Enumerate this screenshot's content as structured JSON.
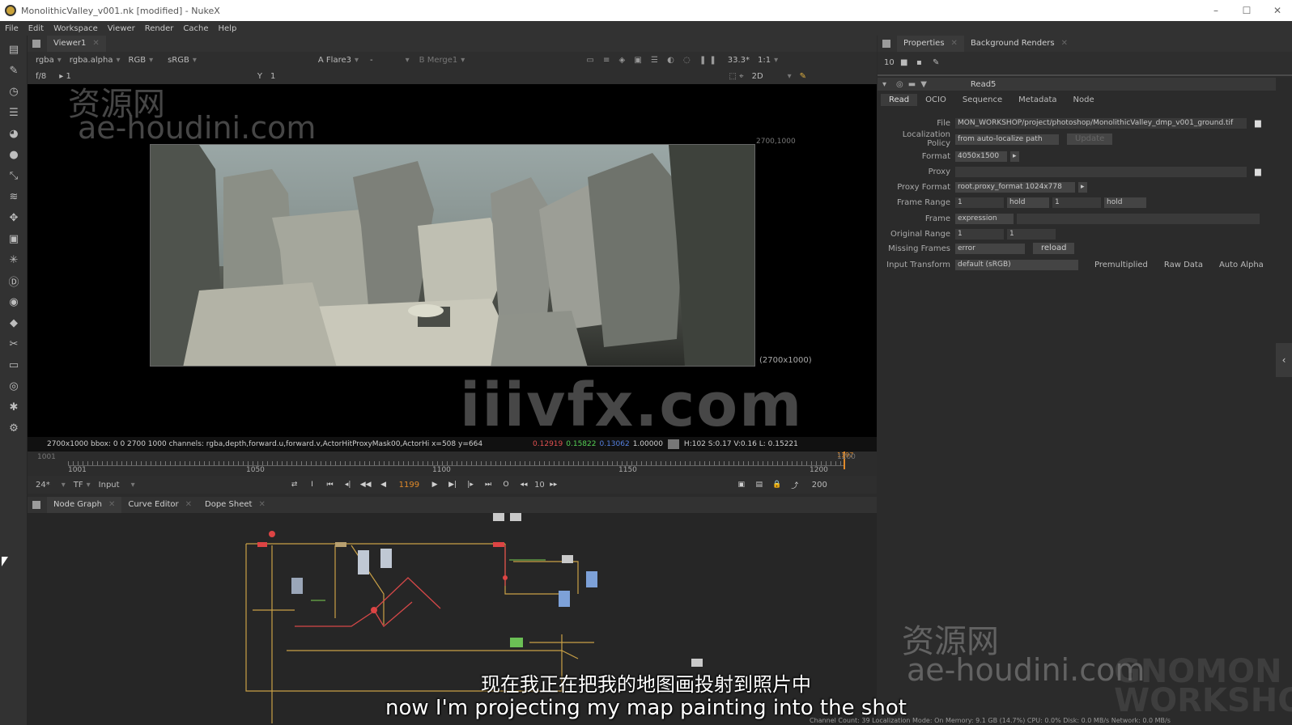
{
  "window": {
    "title": "MonolithicValley_v001.nk [modified] - NukeX",
    "controls": [
      "–",
      "☐",
      "✕"
    ]
  },
  "menu": [
    "File",
    "Edit",
    "Workspace",
    "Viewer",
    "Render",
    "Cache",
    "Help"
  ],
  "viewer": {
    "tab": "Viewer1",
    "channels": "rgba",
    "alpha": "rgba.alpha",
    "rgb": "RGB",
    "colorspace": "sRGB",
    "input_a": "A  Flare3",
    "input_a_op": "-",
    "input_b": "B  Merge1",
    "zoom": "33.3*",
    "ratio": "1:1",
    "fstop": "f/8",
    "gamma": "1",
    "y_label": "Y",
    "y_value": "1",
    "view_mode": "2D",
    "corner_tr": "2700,1000",
    "corner_br": "(2700x1000)"
  },
  "info_bar": {
    "text": "2700x1000  bbox: 0 0 2700 1000 channels: rgba,depth,forward.u,forward.v,ActorHitProxyMask00,ActorHi  x=508 y=664",
    "r": "0.12919",
    "g": "0.15822",
    "b": "0.13062",
    "a": "1.00000",
    "hsv": "H:102 S:0.17 V:0.16  L: 0.15221"
  },
  "timeline": {
    "start": "1001",
    "end": "1200",
    "ticks": [
      "1001",
      "1050",
      "1100",
      "1150",
      "1200"
    ],
    "playhead": "1197"
  },
  "playback": {
    "fps": "24*",
    "tf": "TF",
    "input": "Input",
    "current_frame": "1199",
    "increment": "10",
    "end_frame": "200"
  },
  "node_graph_tabs": [
    "Node Graph",
    "Curve Editor",
    "Dope Sheet"
  ],
  "properties": {
    "tabs": [
      "Properties",
      "Background Renders"
    ],
    "toolbar_count": "10",
    "node_name": "Read5",
    "subtabs": [
      "Read",
      "OCIO",
      "Sequence",
      "Metadata",
      "Node"
    ],
    "rows": {
      "file_label": "File",
      "file_value": "MON_WORKSHOP/project/photoshop/MonolithicValley_dmp_v001_ground.tif",
      "loc_label": "Localization Policy",
      "loc_value": "from auto-localize path",
      "loc_button": "Update",
      "format_label": "Format",
      "format_value": "4050x1500",
      "proxy_label": "Proxy",
      "proxyfmt_label": "Proxy Format",
      "proxyfmt_value": "root.proxy_format 1024x778",
      "framerange_label": "Frame Range",
      "framerange_start": "1",
      "framerange_before": "hold",
      "framerange_end": "1",
      "framerange_after": "hold",
      "frame_label": "Frame",
      "frame_value": "expression",
      "origrange_label": "Original Range",
      "origrange_start": "1",
      "origrange_end": "1",
      "missing_label": "Missing Frames",
      "missing_value": "error",
      "reload_button": "reload",
      "input_label": "Input Transform",
      "input_value": "default (sRGB)",
      "premult": "Premultiplied",
      "rawdata": "Raw Data",
      "autoalpha": "Auto Alpha"
    }
  },
  "watermarks": {
    "cn_top": "资源网",
    "url_top": "ae-houdini.com",
    "center": "iiivfx.com",
    "cn_bottom": "资源网",
    "url_bottom": "ae-houdini.com",
    "logo_line1": "GNOMON",
    "logo_line2": "WORKSHOP"
  },
  "subtitles": {
    "cn": "现在我正在把我的地图画投射到照片中",
    "en": "now I'm projecting my map painting into the shot"
  },
  "status_bar": "Channel Count: 39  Localization Mode: On  Memory: 9.1 GB (14.7%)  CPU: 0.0%  Disk: 0.0 MB/s  Network: 0.0 MB/s"
}
